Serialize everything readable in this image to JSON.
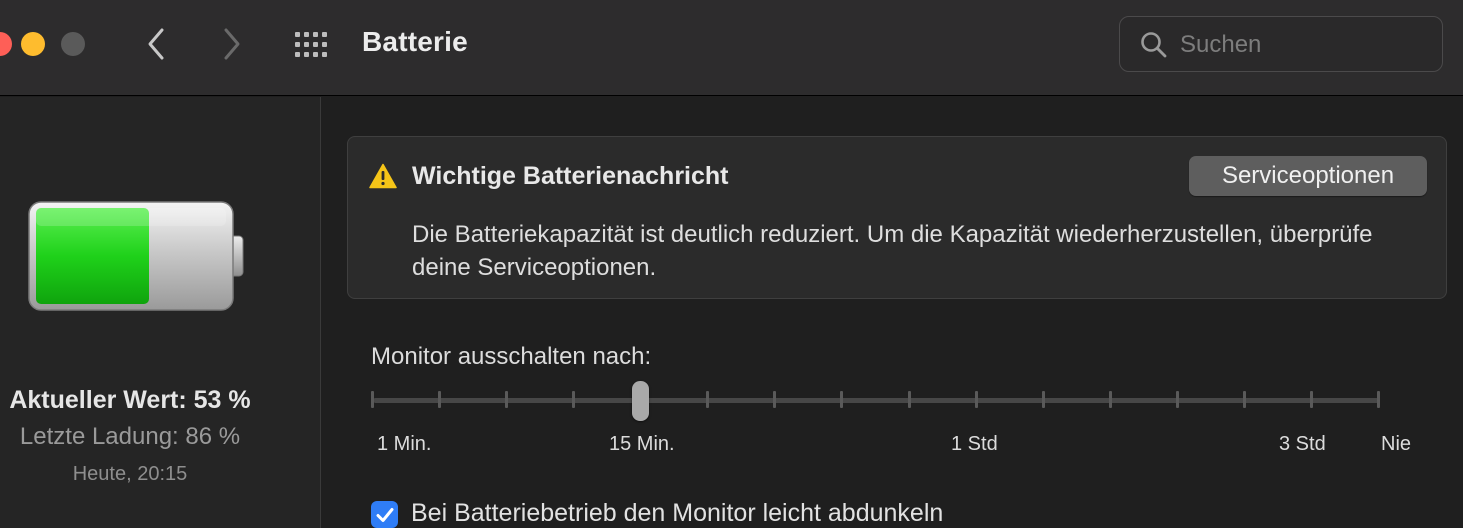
{
  "window": {
    "title": "Batterie"
  },
  "toolbar": {
    "back_icon": "chevron-left-icon",
    "forward_icon": "chevron-right-icon",
    "grid_icon": "grid-icon"
  },
  "search": {
    "placeholder": "Suchen",
    "value": "",
    "icon": "search-icon"
  },
  "sidebar": {
    "battery_level_percent": 53,
    "battery_fill_color": "#1fd11a",
    "current_value": "Aktueller Wert: 53 %",
    "last_charge": "Letzte Ladung: 86 %",
    "time": "Heute, 20:15"
  },
  "notice": {
    "icon": "warning-icon",
    "icon_color": "#f5c518",
    "title": "Wichtige Batterienachricht",
    "button_label": "Serviceoptionen",
    "body": "Die Batteriekapazität ist deutlich reduziert. Um die Kapazität wiederherzustellen, überprüfe deine Serviceoptionen."
  },
  "display_sleep": {
    "label": "Monitor ausschalten nach:",
    "tick_count": 16,
    "selected_tick_index": 4,
    "tick_labels": [
      "1 Min.",
      "15 Min.",
      "1 Std",
      "3 Std",
      "Nie"
    ]
  },
  "dim_option": {
    "checked": true,
    "accent_color": "#2f7df6",
    "label": "Bei Batteriebetrieb den Monitor leicht abdunkeln"
  }
}
